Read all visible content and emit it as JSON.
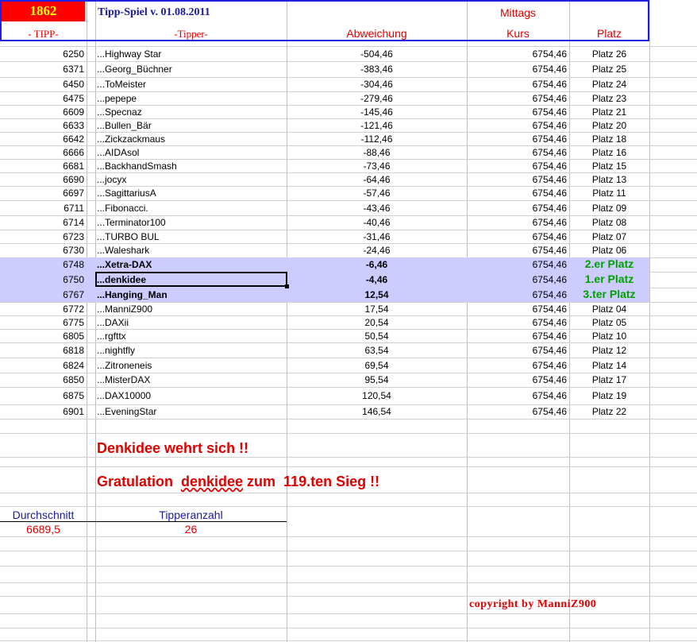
{
  "header": {
    "number": "1862",
    "title": "Tipp-Spiel v. 01.08.2011",
    "time_label": "Mittags",
    "col_tipp": "- TIPP-",
    "col_tipper": "-Tipper-",
    "col_abweichung": "Abweichung",
    "col_kurs": "Kurs",
    "col_platz": "Platz"
  },
  "rows": [
    {
      "tipp": "6250",
      "name": "...Highway Star",
      "abw": "-504,46",
      "kurs": "6754,46",
      "platz": "Platz 26"
    },
    {
      "tipp": "6371",
      "name": "...Georg_Büchner",
      "abw": "-383,46",
      "kurs": "6754,46",
      "platz": "Platz 25"
    },
    {
      "tipp": "6450",
      "name": "...ToMeister",
      "abw": "-304,46",
      "kurs": "6754,46",
      "platz": "Platz 24"
    },
    {
      "tipp": "6475",
      "name": "...pepepe",
      "abw": "-279,46",
      "kurs": "6754,46",
      "platz": "Platz 23"
    },
    {
      "tipp": "6609",
      "name": "...Specnaz",
      "abw": "-145,46",
      "kurs": "6754,46",
      "platz": "Platz 21"
    },
    {
      "tipp": "6633",
      "name": "...Bullen_Bär",
      "abw": "-121,46",
      "kurs": "6754,46",
      "platz": "Platz 20"
    },
    {
      "tipp": "6642",
      "name": "...Zickzackmaus",
      "abw": "-112,46",
      "kurs": "6754,46",
      "platz": "Platz 18"
    },
    {
      "tipp": "6666",
      "name": "...AIDAsol",
      "abw": "-88,46",
      "kurs": "6754,46",
      "platz": "Platz 16"
    },
    {
      "tipp": "6681",
      "name": "...BackhandSmash",
      "abw": "-73,46",
      "kurs": "6754,46",
      "platz": "Platz 15"
    },
    {
      "tipp": "6690",
      "name": "...jocyx",
      "abw": "-64,46",
      "kurs": "6754,46",
      "platz": "Platz 13"
    },
    {
      "tipp": "6697",
      "name": "...SagittariusA",
      "abw": "-57,46",
      "kurs": "6754,46",
      "platz": "Platz 11"
    },
    {
      "tipp": "6711",
      "name": "...Fibonacci.",
      "abw": "-43,46",
      "kurs": "6754,46",
      "platz": "Platz 09"
    },
    {
      "tipp": "6714",
      "name": "...Terminator100",
      "abw": "-40,46",
      "kurs": "6754,46",
      "platz": "Platz 08"
    },
    {
      "tipp": "6723",
      "name": "...TURBO BUL",
      "abw": "-31,46",
      "kurs": "6754,46",
      "platz": "Platz 07"
    },
    {
      "tipp": "6730",
      "name": "...Waleshark",
      "abw": "-24,46",
      "kurs": "6754,46",
      "platz": "Platz 06"
    },
    {
      "tipp": "6748",
      "name": "...Xetra-DAX",
      "abw": "-6,46",
      "kurs": "6754,46",
      "platz": "2.er Platz",
      "highlight": true
    },
    {
      "tipp": "6750",
      "name": "...denkidee",
      "abw": "-4,46",
      "kurs": "6754,46",
      "platz": "1.er Platz",
      "highlight": true
    },
    {
      "tipp": "6767",
      "name": "...Hanging_Man",
      "abw": "12,54",
      "kurs": "6754,46",
      "platz": "3.ter Platz",
      "highlight": true
    },
    {
      "tipp": "6772",
      "name": "...ManniZ900",
      "abw": "17,54",
      "kurs": "6754,46",
      "platz": "Platz 04"
    },
    {
      "tipp": "6775",
      "name": "...DAXii",
      "abw": "20,54",
      "kurs": "6754,46",
      "platz": "Platz 05"
    },
    {
      "tipp": "6805",
      "name": "...rgfttx",
      "abw": "50,54",
      "kurs": "6754,46",
      "platz": "Platz 10"
    },
    {
      "tipp": "6818",
      "name": "...nightfly",
      "abw": "63,54",
      "kurs": "6754,46",
      "platz": "Platz 12"
    },
    {
      "tipp": "6824",
      "name": "...Zitroneneis",
      "abw": "69,54",
      "kurs": "6754,46",
      "platz": "Platz 14"
    },
    {
      "tipp": "6850",
      "name": "...MisterDAX",
      "abw": "95,54",
      "kurs": "6754,46",
      "platz": "Platz 17"
    },
    {
      "tipp": "6875",
      "name": "...DAX10000",
      "abw": "120,54",
      "kurs": "6754,46",
      "platz": "Platz 19"
    },
    {
      "tipp": "6901",
      "name": "...EveningStar",
      "abw": "146,54",
      "kurs": "6754,46",
      "platz": "Platz 22"
    }
  ],
  "messages": {
    "line1": "Denkidee wehrt sich !!",
    "line2_a": "Gratulation  ",
    "line2_b": "denkidee",
    "line2_c": " zum  119.ten Sieg !!"
  },
  "summary": {
    "avg_label": "Durchschnitt",
    "avg_value": "6689,5",
    "count_label": "Tipperanzahl",
    "count_value": "26"
  },
  "copyright": "copyright by ManniZ900",
  "colors": {
    "accent_red": "#e00000",
    "header_blue": "#2020e0",
    "highlight": "#ccccff",
    "green": "#00a000"
  }
}
